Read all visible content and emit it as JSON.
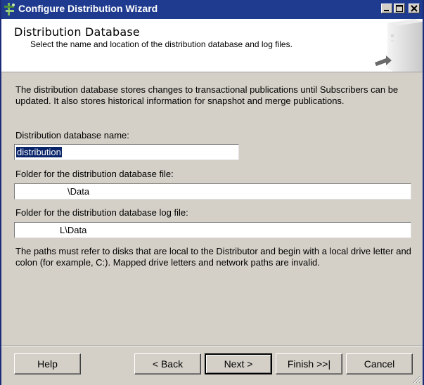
{
  "window": {
    "title": "Configure Distribution Wizard"
  },
  "header": {
    "title": "Distribution Database",
    "subtitle": "Select the name and location of the distribution database and log files."
  },
  "main": {
    "description": "The distribution database stores changes to transactional publications until Subscribers can be updated. It also stores historical information for snapshot and merge publications.",
    "db_name_label": "Distribution database name:",
    "db_name_value": "distribution",
    "data_folder_label": "Folder for the distribution database file:",
    "data_folder_value": "\\Data",
    "log_folder_label": "Folder for the distribution database log file:",
    "log_folder_value": "L\\Data",
    "note": "The paths must refer to disks that are local to the Distributor and begin with a local drive letter and colon (for example, C:). Mapped drive letters and network paths are invalid."
  },
  "buttons": {
    "help": "Help",
    "back": "< Back",
    "next": "Next >",
    "finish": "Finish >>|",
    "cancel": "Cancel"
  },
  "icons": [
    "wizard-app-icon",
    "minimize-icon",
    "maximize-icon",
    "close-icon",
    "server-icon",
    "resize-grip-icon"
  ],
  "colors": {
    "titlebar": "#1f3b8f",
    "dialog": "#d4d0c8",
    "selection": "#0a246a"
  }
}
